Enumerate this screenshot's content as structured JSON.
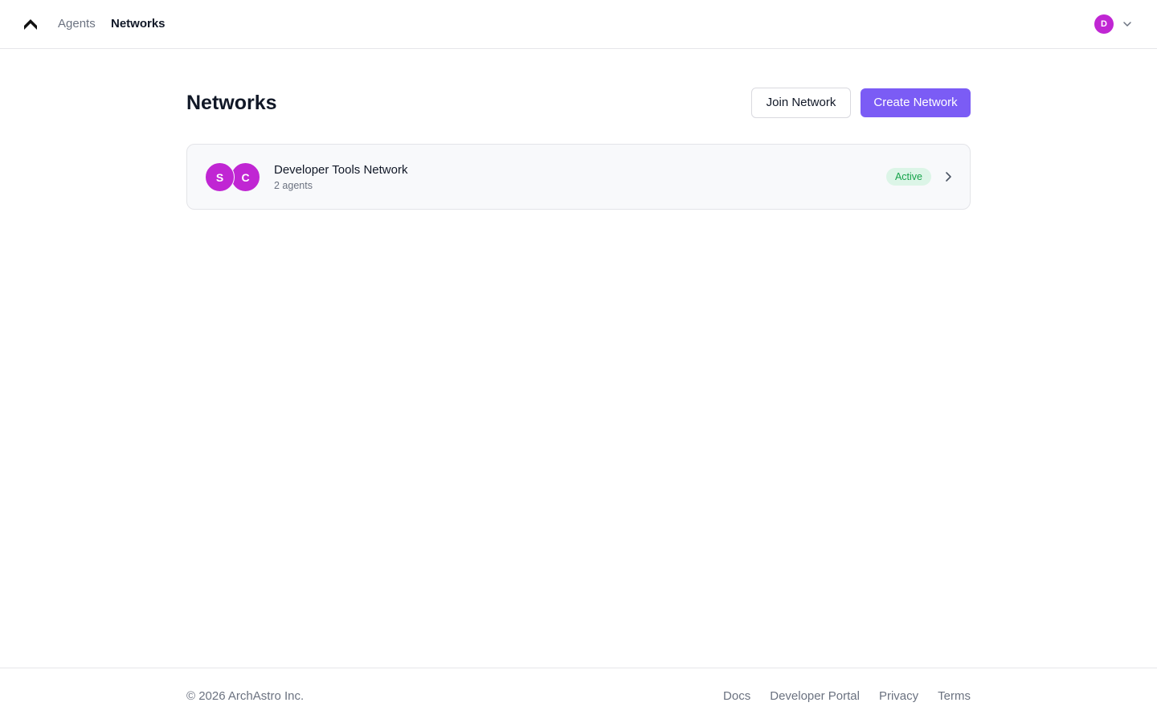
{
  "colors": {
    "accent": "#7b5cf5",
    "avatar": "#c026d3",
    "badge_bg": "#dcf5e7",
    "badge_text": "#16a34a"
  },
  "header": {
    "logo_icon": "archastro-logo-icon",
    "nav": [
      {
        "label": "Agents",
        "active": false
      },
      {
        "label": "Networks",
        "active": true
      }
    ],
    "user": {
      "initial": "D",
      "menu_icon": "chevron-down-icon"
    }
  },
  "main": {
    "title": "Networks",
    "join_label": "Join Network",
    "create_label": "Create Network",
    "networks": [
      {
        "name": "Developer Tools Network",
        "subtitle": "2 agents",
        "status": "Active",
        "agents": [
          {
            "initial": "S"
          },
          {
            "initial": "C"
          }
        ],
        "open_icon": "chevron-right-icon"
      }
    ]
  },
  "footer": {
    "copyright": "© 2026 ArchAstro Inc.",
    "links": [
      "Docs",
      "Developer Portal",
      "Privacy",
      "Terms"
    ]
  }
}
